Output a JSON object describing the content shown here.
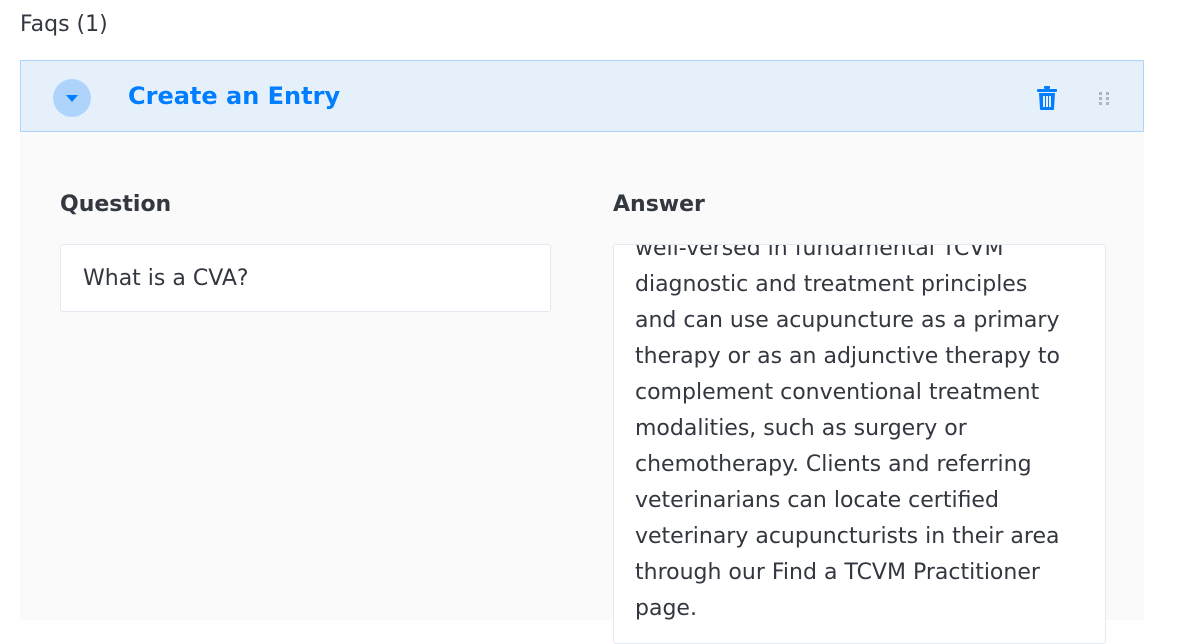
{
  "section": {
    "title": "Faqs (1)"
  },
  "entry": {
    "title": "Create an Entry",
    "toggle_icon": "caret-down-icon",
    "delete_icon": "trash-icon",
    "drag_icon": "drag-handle-icon"
  },
  "fields": {
    "question_label": "Question",
    "question_value": "What is a CVA?",
    "answer_label": "Answer",
    "answer_lines": [
      "well-versed in fundamental TCVM",
      "diagnostic and treatment principles",
      "and can use acupuncture as a primary",
      "therapy or as an adjunctive therapy to",
      "complement conventional treatment",
      "modalities, such as surgery or",
      "chemotherapy. Clients and referring",
      "veterinarians can locate certified",
      "veterinary acupuncturists in their area",
      "through our Find a TCVM Practitioner",
      "page."
    ]
  },
  "colors": {
    "accent": "#007eff",
    "header_bg": "#e6f0fb",
    "header_border": "#aed4fb",
    "body_bg": "#fafafb",
    "text": "#333740"
  }
}
